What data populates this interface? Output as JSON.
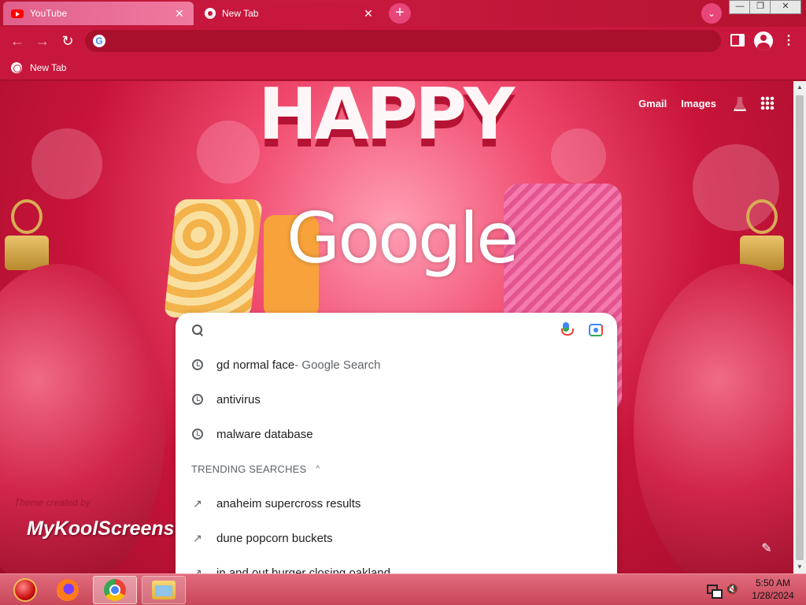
{
  "tabs": [
    {
      "title": "YouTube",
      "close": "✕"
    },
    {
      "title": "New Tab",
      "close": "✕"
    }
  ],
  "new_tab_button": "+",
  "tab_search_button": "⌄",
  "window_controls": {
    "minimize": "—",
    "maximize": "❐",
    "close": "✕"
  },
  "toolbar": {
    "back": "←",
    "forward": "→",
    "reload": "↻",
    "omnibox_value": "",
    "omnibox_icon": "G",
    "menu": "⋮"
  },
  "bookmarks": [
    {
      "label": "New Tab"
    }
  ],
  "page": {
    "top_links": {
      "gmail": "Gmail",
      "images": "Images"
    },
    "logo": "Google",
    "theme_credit": "Theme created by",
    "theme_brand": "MyKoolScreens",
    "customize_icon": "✎"
  },
  "search": {
    "input_value": "",
    "suggestions": [
      {
        "text": "gd normal face",
        "suffix": " - Google Search"
      },
      {
        "text": "antivirus",
        "suffix": ""
      },
      {
        "text": "malware database",
        "suffix": ""
      }
    ],
    "trending_header": "TRENDING SEARCHES",
    "trending_toggle": "^",
    "trending": [
      {
        "text": "anaheim supercross results"
      },
      {
        "text": "dune popcorn buckets"
      },
      {
        "text": "in and out burger closing oakland"
      }
    ]
  },
  "scrollbar": {
    "up": "▲",
    "down": "▼"
  },
  "taskbar": {
    "clock_time": "5:50 AM",
    "clock_date": "1/28/2024",
    "volume_icon": "🔇"
  }
}
